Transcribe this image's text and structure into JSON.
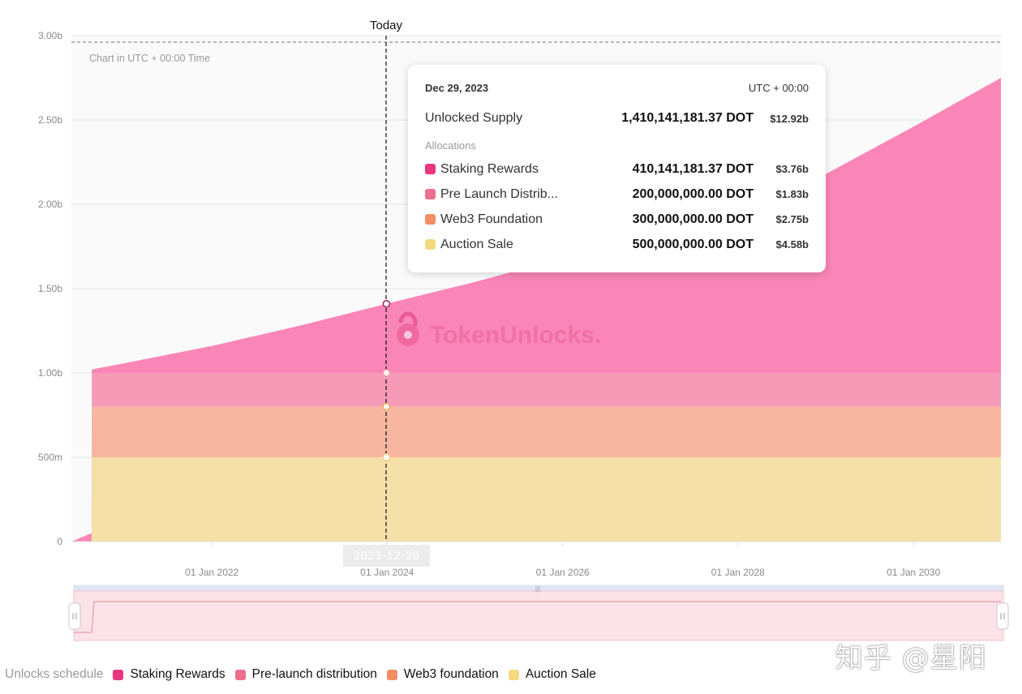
{
  "chart_data": {
    "type": "area",
    "stacked": true,
    "note": "Chart in UTC + 00:00 Time",
    "today_label": "Today",
    "selected_date_pill": "2023-12-29",
    "x_ticks": [
      "01 Jan 2022",
      "01 Jan 2024",
      "01 Jan 2026",
      "01 Jan 2028",
      "01 Jan 2030"
    ],
    "y_ticks": [
      "0",
      "500m",
      "1.00b",
      "1.50b",
      "2.00b",
      "2.50b",
      "3.00b"
    ],
    "ylim": [
      0,
      3000000000
    ],
    "xlim": [
      "2020-05-26",
      "2030-12-31"
    ],
    "grid": true,
    "legend_position": "bottom-left",
    "x": [
      "2020-05-26",
      "2020-08-18",
      "2020-08-19",
      "2021-06-01",
      "2022-01-01",
      "2023-01-01",
      "2023-12-29",
      "2025-01-01",
      "2026-01-01",
      "2027-01-01",
      "2028-01-01",
      "2029-01-01",
      "2030-01-01",
      "2030-12-31"
    ],
    "series": [
      {
        "name": "Auction Sale",
        "color": "#f5e0a8",
        "values": [
          0,
          0,
          500000000,
          500000000,
          500000000,
          500000000,
          500000000,
          500000000,
          500000000,
          500000000,
          500000000,
          500000000,
          500000000,
          500000000
        ]
      },
      {
        "name": "Web3 foundation",
        "color": "#f7b69f",
        "values": [
          0,
          0,
          300000000,
          300000000,
          300000000,
          300000000,
          300000000,
          300000000,
          300000000,
          300000000,
          300000000,
          300000000,
          300000000,
          300000000
        ]
      },
      {
        "name": "Pre-launch distribution",
        "color": "#f59bb8",
        "values": [
          0,
          0,
          200000000,
          200000000,
          200000000,
          200000000,
          200000000,
          200000000,
          200000000,
          200000000,
          200000000,
          200000000,
          200000000,
          200000000
        ]
      },
      {
        "name": "Staking Rewards",
        "color": "#f986b6",
        "values": [
          0,
          50000000,
          20000000,
          100000000,
          160000000,
          280000000,
          410141181,
          540000000,
          680000000,
          830000000,
          1000000000,
          1180000000,
          1460000000,
          1750000000
        ]
      }
    ],
    "tooltip": {
      "date": "Dec 29, 2023",
      "timezone": "UTC + 00:00",
      "supply_label": "Unlocked Supply",
      "supply_amount": "1,410,141,181.37 DOT",
      "supply_usd": "$12.92b",
      "allocations_title": "Allocations",
      "items": [
        {
          "label": "Staking Rewards",
          "amount": "410,141,181.37 DOT",
          "usd": "$3.76b",
          "color": "#e8367f"
        },
        {
          "label": "Pre Launch Distrib...",
          "amount": "200,000,000.00 DOT",
          "usd": "$1.83b",
          "color": "#ec6f8e"
        },
        {
          "label": "Web3 Foundation",
          "amount": "300,000,000.00 DOT",
          "usd": "$2.75b",
          "color": "#f28d64"
        },
        {
          "label": "Auction Sale",
          "amount": "500,000,000.00 DOT",
          "usd": "$4.58b",
          "color": "#f5d97e"
        }
      ]
    },
    "watermark": "TokenUnlocks."
  },
  "legend": {
    "title": "Unlocks schedule",
    "items": [
      {
        "label": "Staking Rewards",
        "color": "#e8367f"
      },
      {
        "label": "Pre-launch distribution",
        "color": "#ec6f8e"
      },
      {
        "label": "Web3 foundation",
        "color": "#f28d64"
      },
      {
        "label": "Auction Sale",
        "color": "#f5d97e"
      }
    ]
  },
  "brand": "知乎 @星阳"
}
